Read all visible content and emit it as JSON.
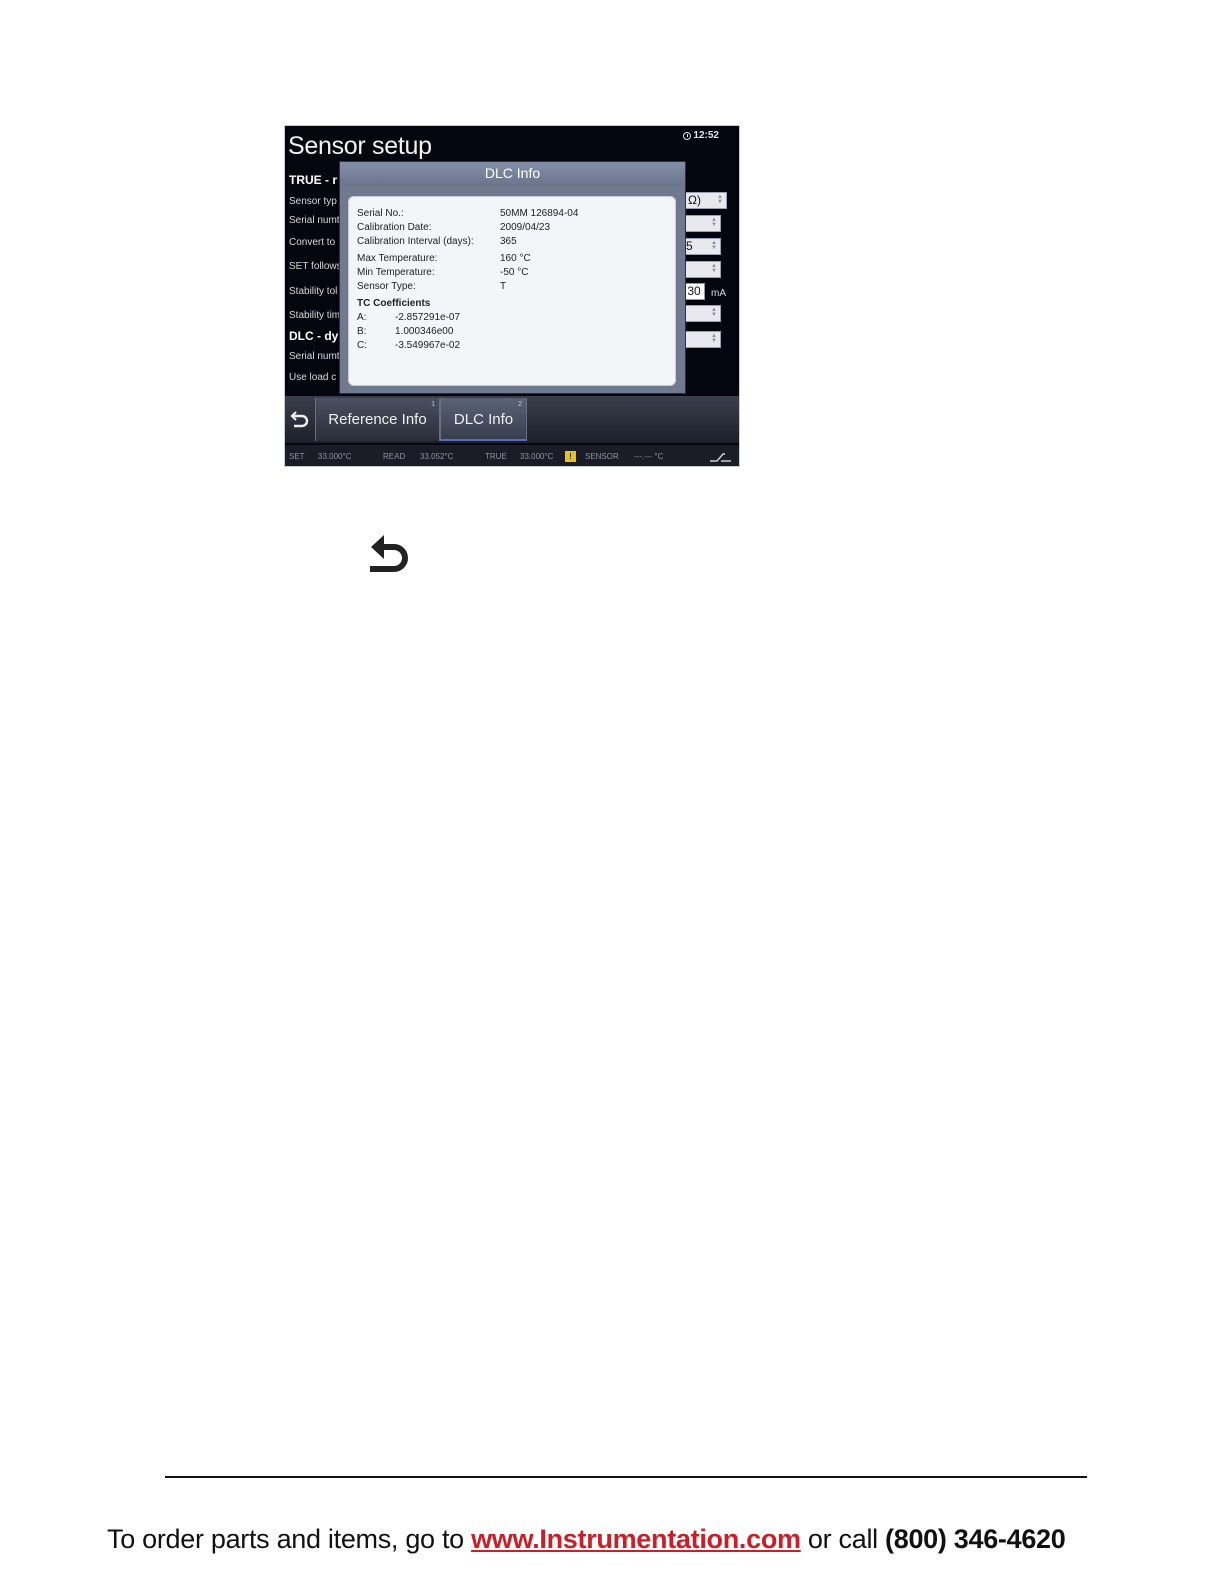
{
  "screen": {
    "title": "Sensor setup",
    "clock": "12:52",
    "background_labels": [
      "TRUE - r",
      "Sensor typ",
      "Serial numt",
      "Convert to",
      "SET follows",
      "Stability tol",
      "Stability tim",
      "DLC - dy",
      "Serial numt",
      "Use load c"
    ],
    "right_fields": [
      "Ω)",
      "",
      "5",
      "",
      "",
      ""
    ],
    "current_value": "30",
    "current_unit": "mA"
  },
  "dialog": {
    "title": "DLC Info",
    "rows": [
      {
        "label": "Serial No.:",
        "value": "50MM 126894-04"
      },
      {
        "label": "Calibration Date:",
        "value": "2009/04/23"
      },
      {
        "label": "Calibration Interval (days):",
        "value": "365"
      },
      {
        "label": "Max Temperature:",
        "value": "160 °C"
      },
      {
        "label": "Min Temperature:",
        "value": "-50 °C"
      },
      {
        "label": "Sensor Type:",
        "value": "T"
      }
    ],
    "coef_heading": "TC Coefficients",
    "coefficients": [
      {
        "label": "A:",
        "value": "-2.857291e-07"
      },
      {
        "label": "B:",
        "value": "1.000346e00"
      },
      {
        "label": "C:",
        "value": "-3.549967e-02"
      }
    ]
  },
  "tabs": [
    {
      "label": "Reference Info",
      "num": "1"
    },
    {
      "label": "DLC Info",
      "num": "2"
    }
  ],
  "status": {
    "set_label": "SET",
    "set_value": "33.000°C",
    "read_label": "READ",
    "read_value": "33.052°C",
    "true_label": "TRUE",
    "true_value": "33.000°C",
    "warn": "!",
    "sensor_label": "SENSOR",
    "sensor_value": "---.--- °C"
  },
  "footer": {
    "prefix": "To order parts and items, go to ",
    "link": "www.Instrumentation.com",
    "middle": " or call ",
    "phone": "(800) 346-4620"
  }
}
